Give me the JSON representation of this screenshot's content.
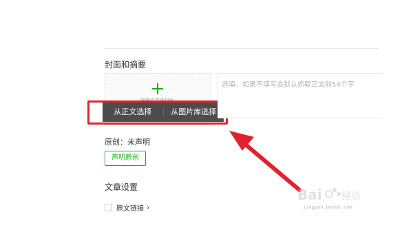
{
  "cover_section": {
    "title": "封面和摘要",
    "add_icon": "plus-icon",
    "hint": "拖拽或选择封面",
    "menu": {
      "from_body_label": "从正文选择",
      "from_library_label": "从图片库选择"
    }
  },
  "summary": {
    "placeholder": "选填，如果不填写会默认抓取正文前54个字"
  },
  "original": {
    "status": "原创：未声明",
    "declare_label": "声明原创"
  },
  "article_settings": {
    "title": "文章设置",
    "source_link_label": "原文链接",
    "source_link_checked": false,
    "chevron_icon": "chevron-right-icon"
  },
  "annotation": {
    "highlight_color": "#e3212c",
    "arrow_icon": "red-arrow-icon"
  },
  "watermark": {
    "brand": "Baidu 经验",
    "domain": "jingyan.baidu.com"
  },
  "colors": {
    "accent_green": "#1aad19",
    "menu_bg": "#4c4c4c"
  }
}
